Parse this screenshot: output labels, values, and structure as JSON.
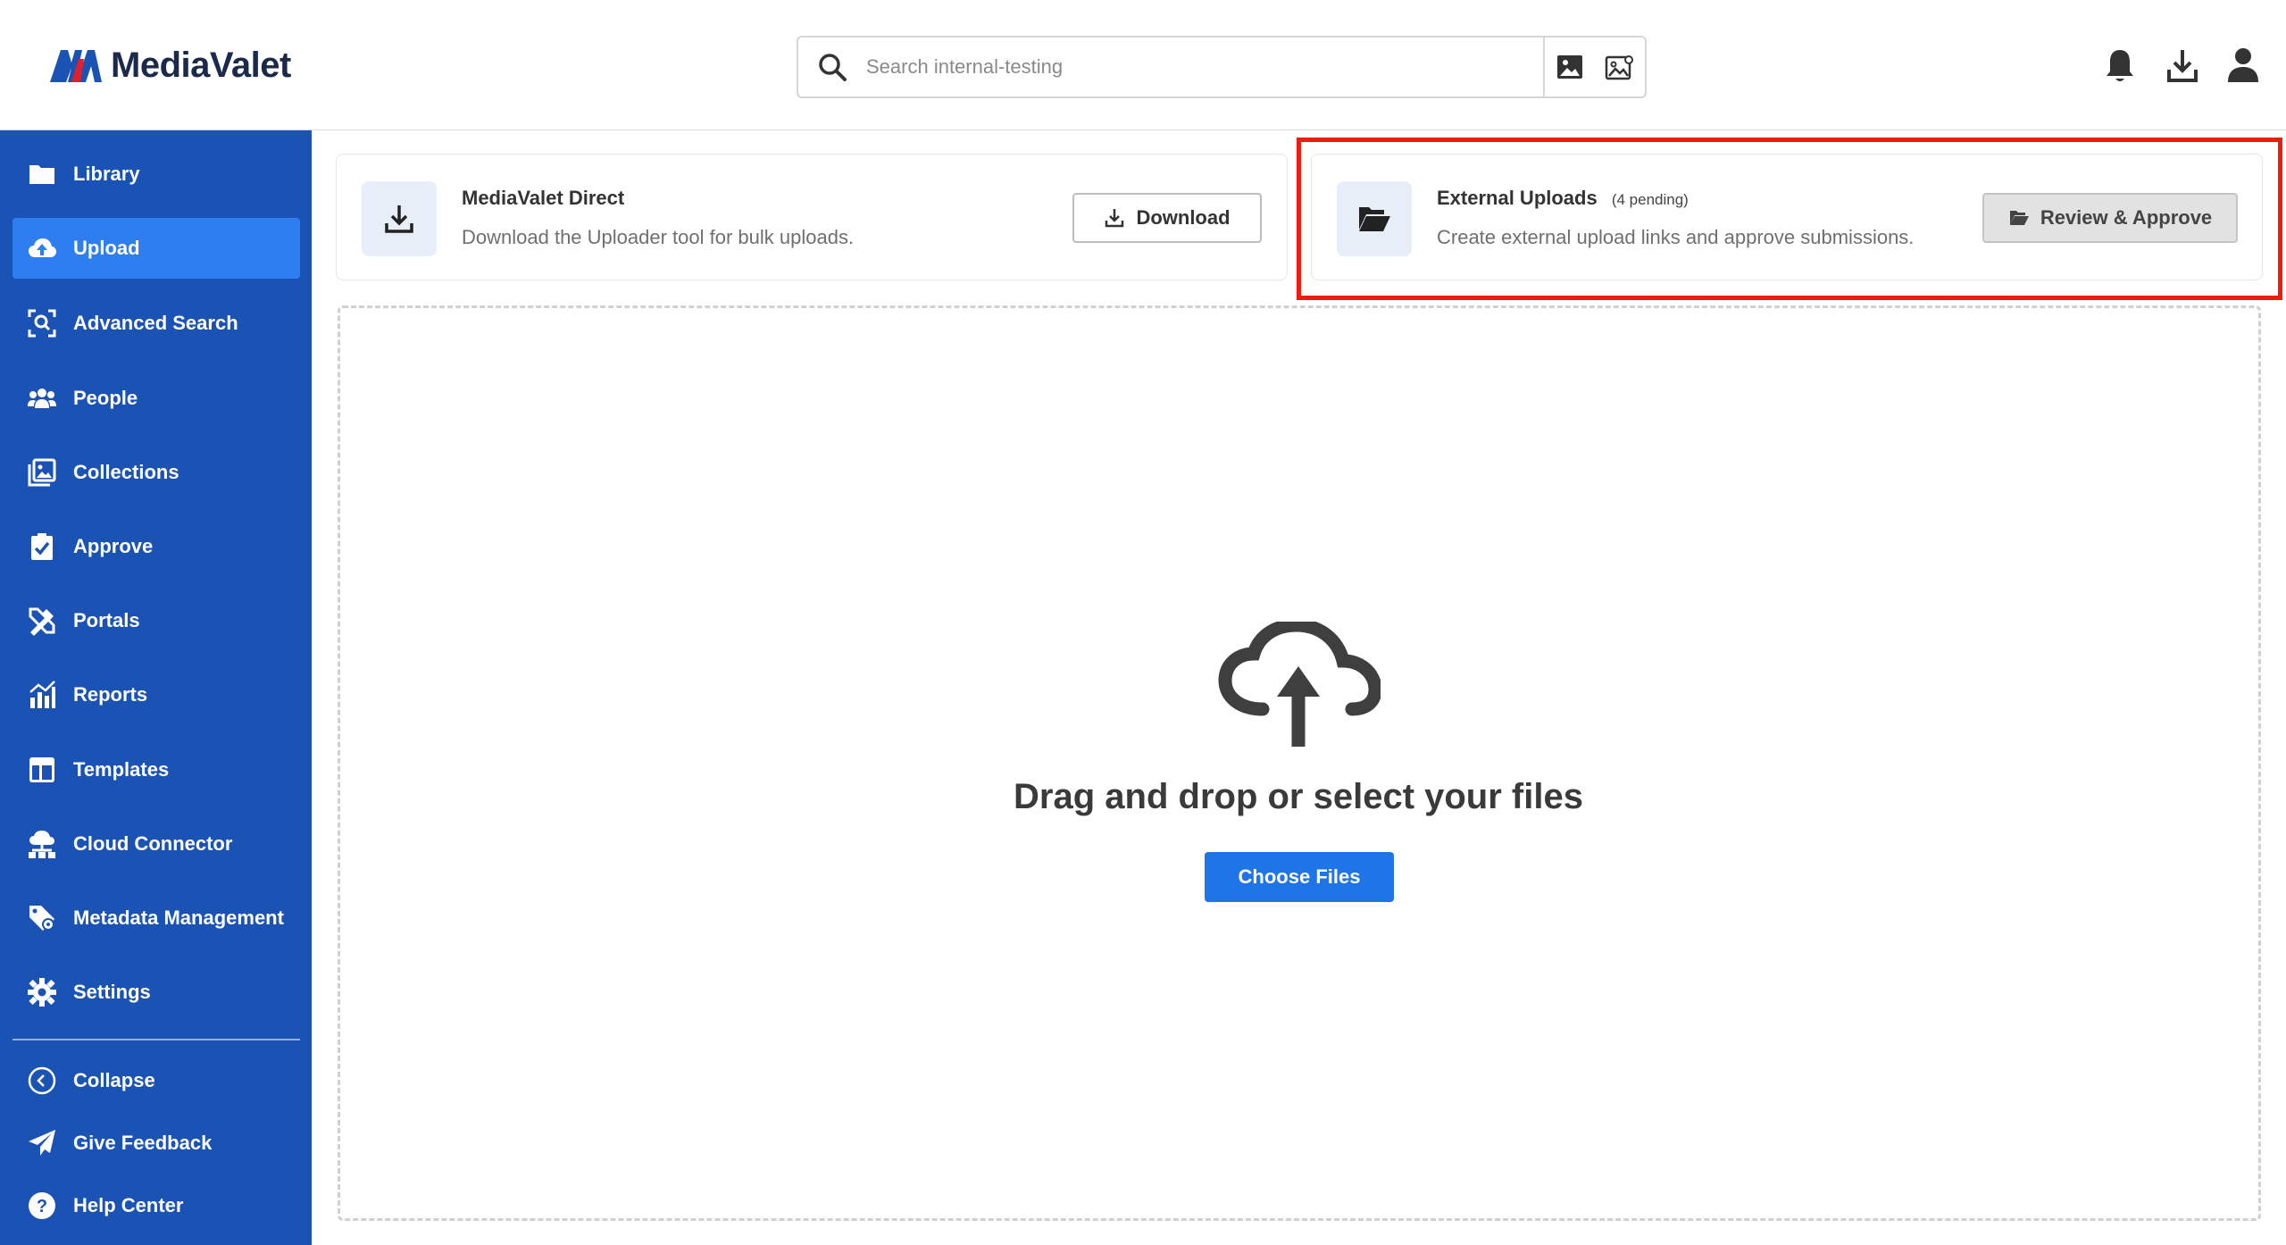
{
  "brand": {
    "name": "MediaValet",
    "logo_color": "#1a53b4",
    "accent_color": "#e0202a"
  },
  "search": {
    "placeholder": "Search internal-testing"
  },
  "header_icons": [
    "bell-icon",
    "download-icon",
    "user-icon"
  ],
  "sidebar": {
    "items": [
      {
        "label": "Library",
        "icon": "folder-icon",
        "active": false
      },
      {
        "label": "Upload",
        "icon": "cloud-upload-icon",
        "active": true
      },
      {
        "label": "Advanced Search",
        "icon": "face-search-icon",
        "active": false
      },
      {
        "label": "People",
        "icon": "people-icon",
        "active": false
      },
      {
        "label": "Collections",
        "icon": "collections-icon",
        "active": false
      },
      {
        "label": "Approve",
        "icon": "clipboard-check-icon",
        "active": false
      },
      {
        "label": "Portals",
        "icon": "tools-icon",
        "active": false
      },
      {
        "label": "Reports",
        "icon": "chart-icon",
        "active": false
      },
      {
        "label": "Templates",
        "icon": "template-icon",
        "active": false
      },
      {
        "label": "Cloud Connector",
        "icon": "cloud-network-icon",
        "active": false
      },
      {
        "label": "Metadata Management",
        "icon": "tag-gear-icon",
        "active": false
      },
      {
        "label": "Settings",
        "icon": "gear-icon",
        "active": false
      }
    ],
    "footer": [
      {
        "label": "Collapse",
        "icon": "chevron-left-icon"
      },
      {
        "label": "Give Feedback",
        "icon": "paper-plane-icon"
      },
      {
        "label": "Help Center",
        "icon": "help-icon"
      }
    ]
  },
  "direct_card": {
    "title": "MediaValet Direct",
    "description": "Download the Uploader tool for bulk uploads.",
    "button": "Download"
  },
  "external_card": {
    "title": "External Uploads",
    "pending": "(4 pending)",
    "description": "Create external upload links and approve submissions.",
    "button": "Review & Approve"
  },
  "dropzone": {
    "text": "Drag and drop or select your files",
    "button": "Choose Files",
    "button_color": "#1f74e8"
  }
}
